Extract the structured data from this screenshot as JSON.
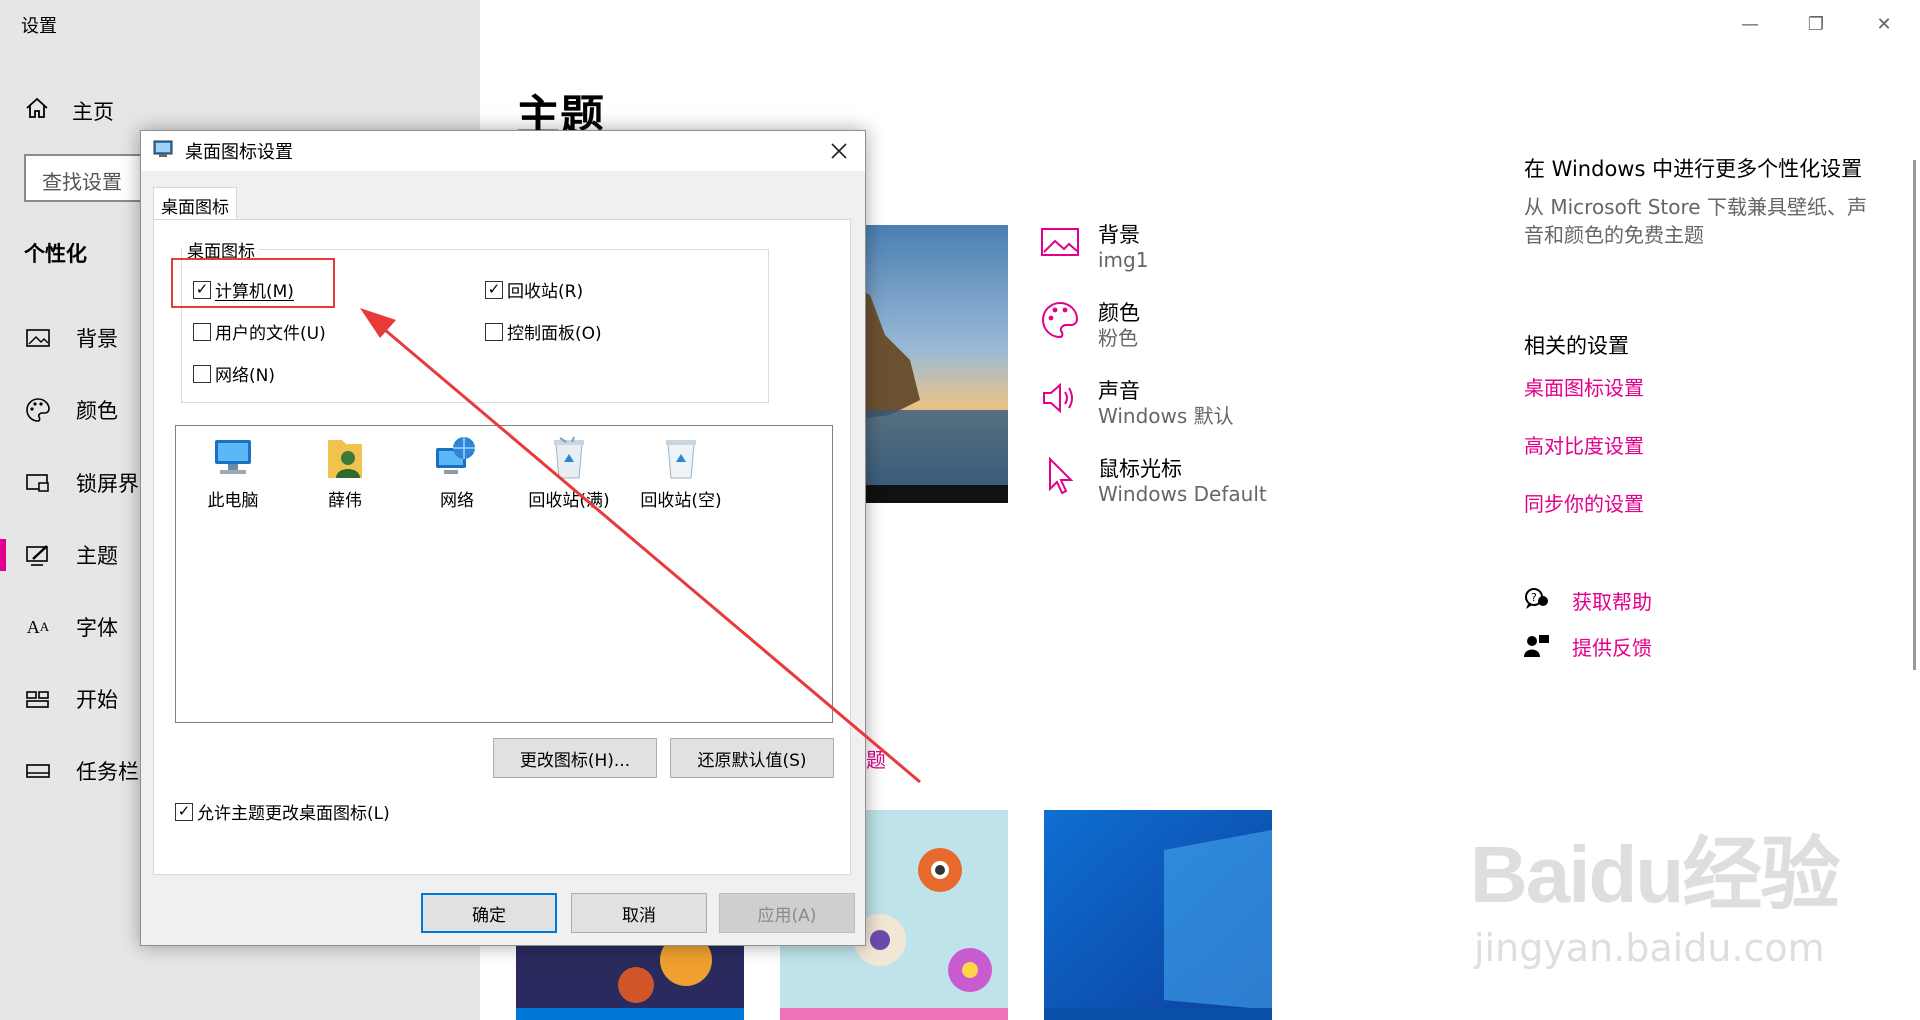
{
  "app": {
    "title": "设置"
  },
  "window_controls": {
    "minimize": "—",
    "restore": "❐",
    "close": "✕"
  },
  "sidebar": {
    "home_label": "主页",
    "search_placeholder": "查找设置",
    "section_title": "个性化",
    "items": [
      {
        "label": "背景",
        "icon": "image-icon"
      },
      {
        "label": "颜色",
        "icon": "palette-icon"
      },
      {
        "label": "锁屏界面",
        "icon": "lock-screen-icon"
      },
      {
        "label": "主题",
        "icon": "theme-icon",
        "active": true
      },
      {
        "label": "字体",
        "icon": "font-icon"
      },
      {
        "label": "开始",
        "icon": "start-icon"
      },
      {
        "label": "任务栏",
        "icon": "taskbar-icon"
      }
    ]
  },
  "main": {
    "title": "主题",
    "props": [
      {
        "label": "背景",
        "value": "img1",
        "icon": "image-icon"
      },
      {
        "label": "颜色",
        "value": "粉色",
        "icon": "palette-icon"
      },
      {
        "label": "声音",
        "value": "Windows 默认",
        "icon": "speaker-icon"
      },
      {
        "label": "鼠标光标",
        "value": "Windows Default",
        "icon": "cursor-icon"
      }
    ],
    "partial_link": "题"
  },
  "right": {
    "more_title": "在 Windows 中进行更多个性化设置",
    "more_desc_line1": "从 Microsoft Store 下载兼具壁纸、声",
    "more_desc_line2": "音和颜色的免费主题",
    "related_title": "相关的设置",
    "links": [
      "桌面图标设置",
      "高对比度设置",
      "同步你的设置"
    ],
    "help": "获取帮助",
    "feedback": "提供反馈"
  },
  "dialog": {
    "title": "桌面图标设置",
    "tab": "桌面图标",
    "group_label": "桌面图标",
    "checkboxes": [
      {
        "label": "计算机(M)",
        "checked": true
      },
      {
        "label": "回收站(R)",
        "checked": true
      },
      {
        "label": "用户的文件(U)",
        "checked": false
      },
      {
        "label": "控制面板(O)",
        "checked": false
      },
      {
        "label": "网络(N)",
        "checked": false
      }
    ],
    "icons": [
      "此电脑",
      "薛伟",
      "网络",
      "回收站(满)",
      "回收站(空)"
    ],
    "change_icon_btn": "更改图标(H)...",
    "restore_default_btn": "还原默认值(S)",
    "allow_themes_label": "允许主题更改桌面图标(L)",
    "allow_themes_checked": true,
    "ok": "确定",
    "cancel": "取消",
    "apply": "应用(A)"
  },
  "watermark": {
    "brand": "Baidu经验",
    "url": "jingyan.baidu.com"
  },
  "colors": {
    "accent": "#e3008c",
    "sidebar_bg": "#e6e6e6",
    "annotation_red": "#e83a3a"
  }
}
